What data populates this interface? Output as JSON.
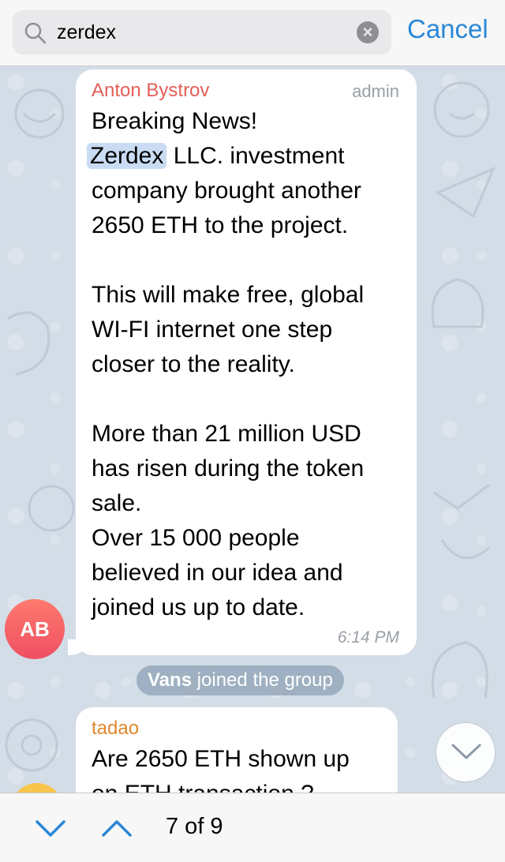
{
  "search": {
    "query": "zerdex",
    "cancel_label": "Cancel"
  },
  "messages": [
    {
      "sender": "Anton Bystrov",
      "role": "admin",
      "lines": [
        "Breaking News!",
        "Zerdex",
        "LLC. investment",
        "company brought another",
        "2650 ETH to the project.",
        "This will make free, global",
        "WI-FI internet one step",
        "closer to the reality.",
        "More than 21 million USD",
        "has risen during the token",
        "sale.",
        "Over 15 000 people",
        "believed in our idea and",
        "joined us up to date."
      ],
      "time": "6:14 PM",
      "avatar_initials": "AB"
    },
    {
      "sender": "tadao",
      "lines": [
        "Are 2650 ETH shown up",
        "on ETH transaction ?"
      ]
    }
  ],
  "service_message": {
    "name": "Vans",
    "text": " joined the group"
  },
  "search_nav": {
    "counter": "7 of 9"
  },
  "colors": {
    "accent": "#2a88d8",
    "anton_name": "#e35e57",
    "tadao_name": "#e0882d",
    "highlight": "#c9dcf3"
  },
  "icons": [
    "search-icon",
    "clear-icon",
    "chevron-down-icon",
    "chevron-up-icon",
    "scroll-down-icon"
  ]
}
